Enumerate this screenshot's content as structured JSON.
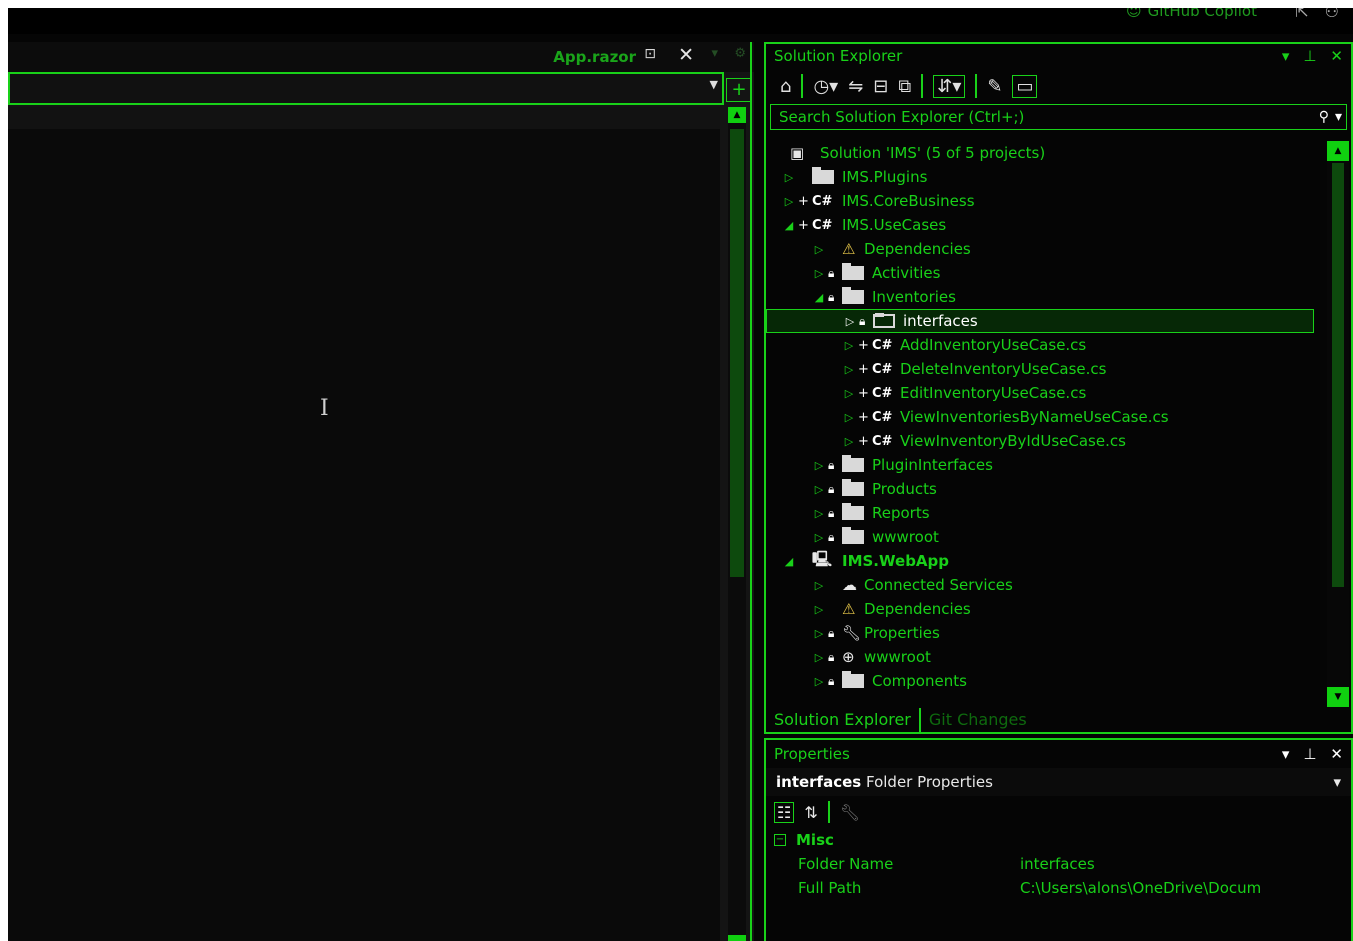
{
  "topbar": {
    "copilot_label": "GitHub Copilot",
    "icons": [
      "copilot-icon",
      "share-icon",
      "account-icon"
    ]
  },
  "editor": {
    "tab_name": "App.razor",
    "pin_glyph": "⊡",
    "close_glyph": "✕",
    "split_glyph": "+",
    "ibeam_glyph": "I"
  },
  "solution_explorer": {
    "title": "Solution Explorer",
    "search_placeholder": "Search Solution Explorer (Ctrl+;)",
    "toolbar": [
      "home-icon",
      "history-icon",
      "sync-icon",
      "collapse-all-icon",
      "show-all-files-icon",
      "scope-icon",
      "properties-icon",
      "preview-icon"
    ],
    "tree": [
      {
        "label": "Solution 'IMS' (5 of 5 projects)",
        "icon": "solution-icon"
      },
      {
        "label": "IMS.Plugins",
        "icon": "folder-icon"
      },
      {
        "label": "IMS.CoreBusiness",
        "icon": "csproj-icon"
      },
      {
        "label": "IMS.UseCases",
        "icon": "csproj-icon"
      },
      {
        "label": "Dependencies",
        "icon": "dependencies-icon"
      },
      {
        "label": "Activities",
        "icon": "folder-icon"
      },
      {
        "label": "Inventories",
        "icon": "folder-icon"
      },
      {
        "label": "interfaces",
        "icon": "folder-icon"
      },
      {
        "label": "AddInventoryUseCase.cs",
        "icon": "csharp-file-icon"
      },
      {
        "label": "DeleteInventoryUseCase.cs",
        "icon": "csharp-file-icon"
      },
      {
        "label": "EditInventoryUseCase.cs",
        "icon": "csharp-file-icon"
      },
      {
        "label": "ViewInventoriesByNameUseCase.cs",
        "icon": "csharp-file-icon"
      },
      {
        "label": "ViewInventoryByIdUseCase.cs",
        "icon": "csharp-file-icon"
      },
      {
        "label": "PluginInterfaces",
        "icon": "folder-icon"
      },
      {
        "label": "Products",
        "icon": "folder-icon"
      },
      {
        "label": "Reports",
        "icon": "folder-icon"
      },
      {
        "label": "wwwroot",
        "icon": "folder-icon"
      },
      {
        "label": "IMS.WebApp",
        "icon": "web-project-icon"
      },
      {
        "label": "Connected Services",
        "icon": "connected-services-icon"
      },
      {
        "label": "Dependencies",
        "icon": "dependencies-icon"
      },
      {
        "label": "Properties",
        "icon": "properties-folder-icon"
      },
      {
        "label": "wwwroot",
        "icon": "globe-icon"
      },
      {
        "label": "Components",
        "icon": "folder-icon"
      }
    ],
    "tabs": [
      "Solution Explorer",
      "Git Changes"
    ],
    "cs_glyph": "C#",
    "csproj_glyph": "C#"
  },
  "properties": {
    "title": "Properties",
    "selected_name": "interfaces",
    "selected_type": "Folder Properties",
    "category": "Misc",
    "rows": [
      {
        "key": "Folder Name",
        "value": "interfaces"
      },
      {
        "key": "Full Path",
        "value": "C:\\Users\\alons\\OneDrive\\Docum"
      }
    ]
  },
  "colors": {
    "accent": "#19d119",
    "background": "#050505",
    "selection": "#062806"
  }
}
